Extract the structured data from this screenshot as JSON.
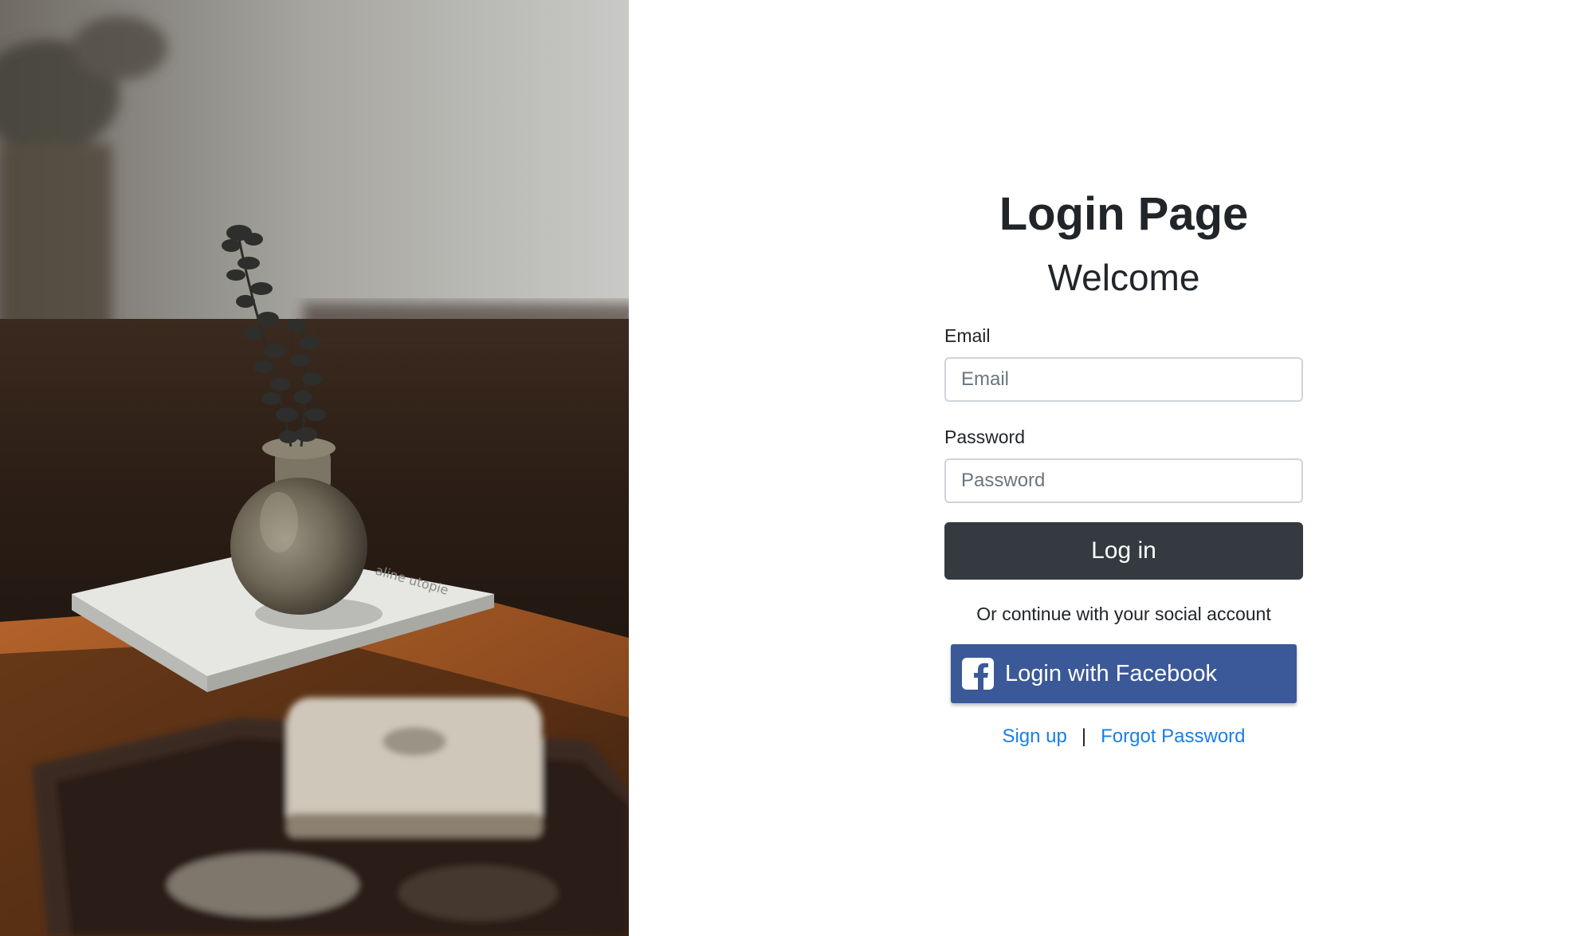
{
  "page": {
    "title": "Login Page",
    "subtitle": "Welcome"
  },
  "form": {
    "email_label": "Email",
    "email_placeholder": "Email",
    "email_value": "",
    "password_label": "Password",
    "password_placeholder": "Password",
    "password_value": "",
    "login_label": "Log in",
    "social_text": "Or continue with your social account",
    "facebook_label": "Login with Facebook",
    "facebook_icon": "facebook-icon"
  },
  "links": {
    "signup": "Sign up",
    "separator": "|",
    "forgot": "Forgot Password"
  },
  "colors": {
    "login_button": "#343a40",
    "facebook_button": "#3b5998",
    "link": "#1a7ee6",
    "text": "#212529"
  },
  "photo": {
    "subject": "photo-vase-on-book"
  }
}
